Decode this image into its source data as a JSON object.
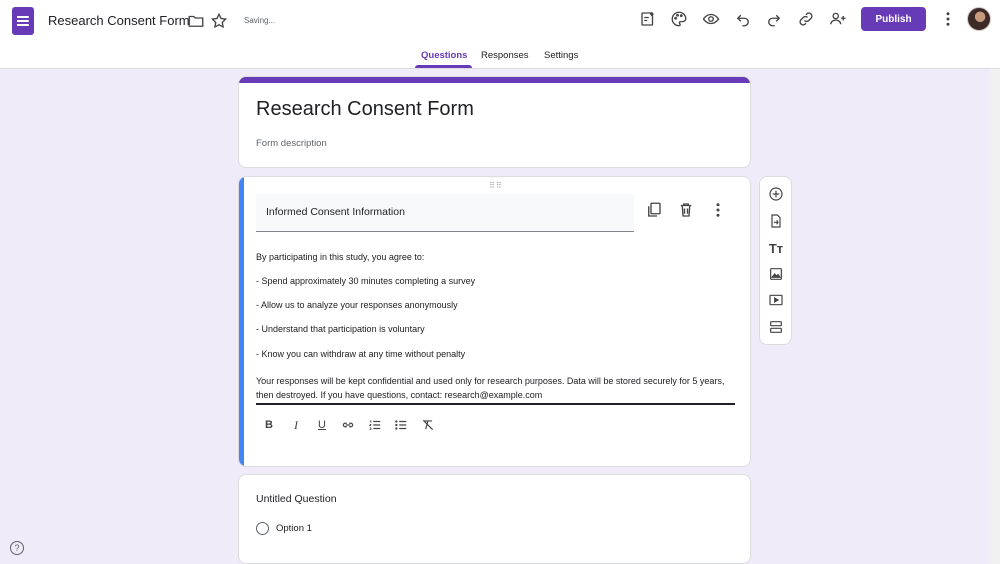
{
  "header": {
    "doc_title": "Research Consent Form",
    "saving_status": "Saving...",
    "publish_label": "Publish"
  },
  "tabs": [
    {
      "label": "Questions",
      "active": true
    },
    {
      "label": "Responses",
      "active": false
    },
    {
      "label": "Settings",
      "active": false
    }
  ],
  "form": {
    "title": "Research Consent Form",
    "description_placeholder": "Form description"
  },
  "section": {
    "title": "Informed Consent Information",
    "intro": "By participating in this study, you agree to:",
    "bullets": [
      "- Spend approximately 30 minutes completing a survey",
      "- Allow us to analyze your responses anonymously",
      "- Understand that participation is voluntary",
      "- Know you can withdraw at any time without penalty"
    ],
    "closing": "Your responses will be kept confidential and used only for research purposes. Data will be stored securely for 5 years, then destroyed. If you have questions, contact: research@example.com"
  },
  "question": {
    "title": "Untitled Question",
    "option_1": "Option 1"
  },
  "help_label": "?",
  "colors": {
    "accent": "#673ab7",
    "section_accent": "#4285f4",
    "background": "#f0ebf8"
  },
  "icons": {
    "header": [
      "folder-icon",
      "star-icon",
      "customize-addon-icon",
      "palette-icon",
      "preview-eye-icon",
      "undo-icon",
      "redo-icon",
      "link-icon",
      "add-collaborator-icon",
      "more-vert-icon"
    ],
    "section_actions": [
      "duplicate-icon",
      "delete-icon",
      "more-vert-icon"
    ],
    "format_toolbar": [
      "bold-icon",
      "italic-icon",
      "underline-icon",
      "link-icon",
      "numbered-list-icon",
      "bulleted-list-icon",
      "clear-format-icon"
    ],
    "side_toolbar": [
      "add-question-icon",
      "import-questions-icon",
      "add-title-icon",
      "add-image-icon",
      "add-video-icon",
      "add-section-icon"
    ]
  }
}
